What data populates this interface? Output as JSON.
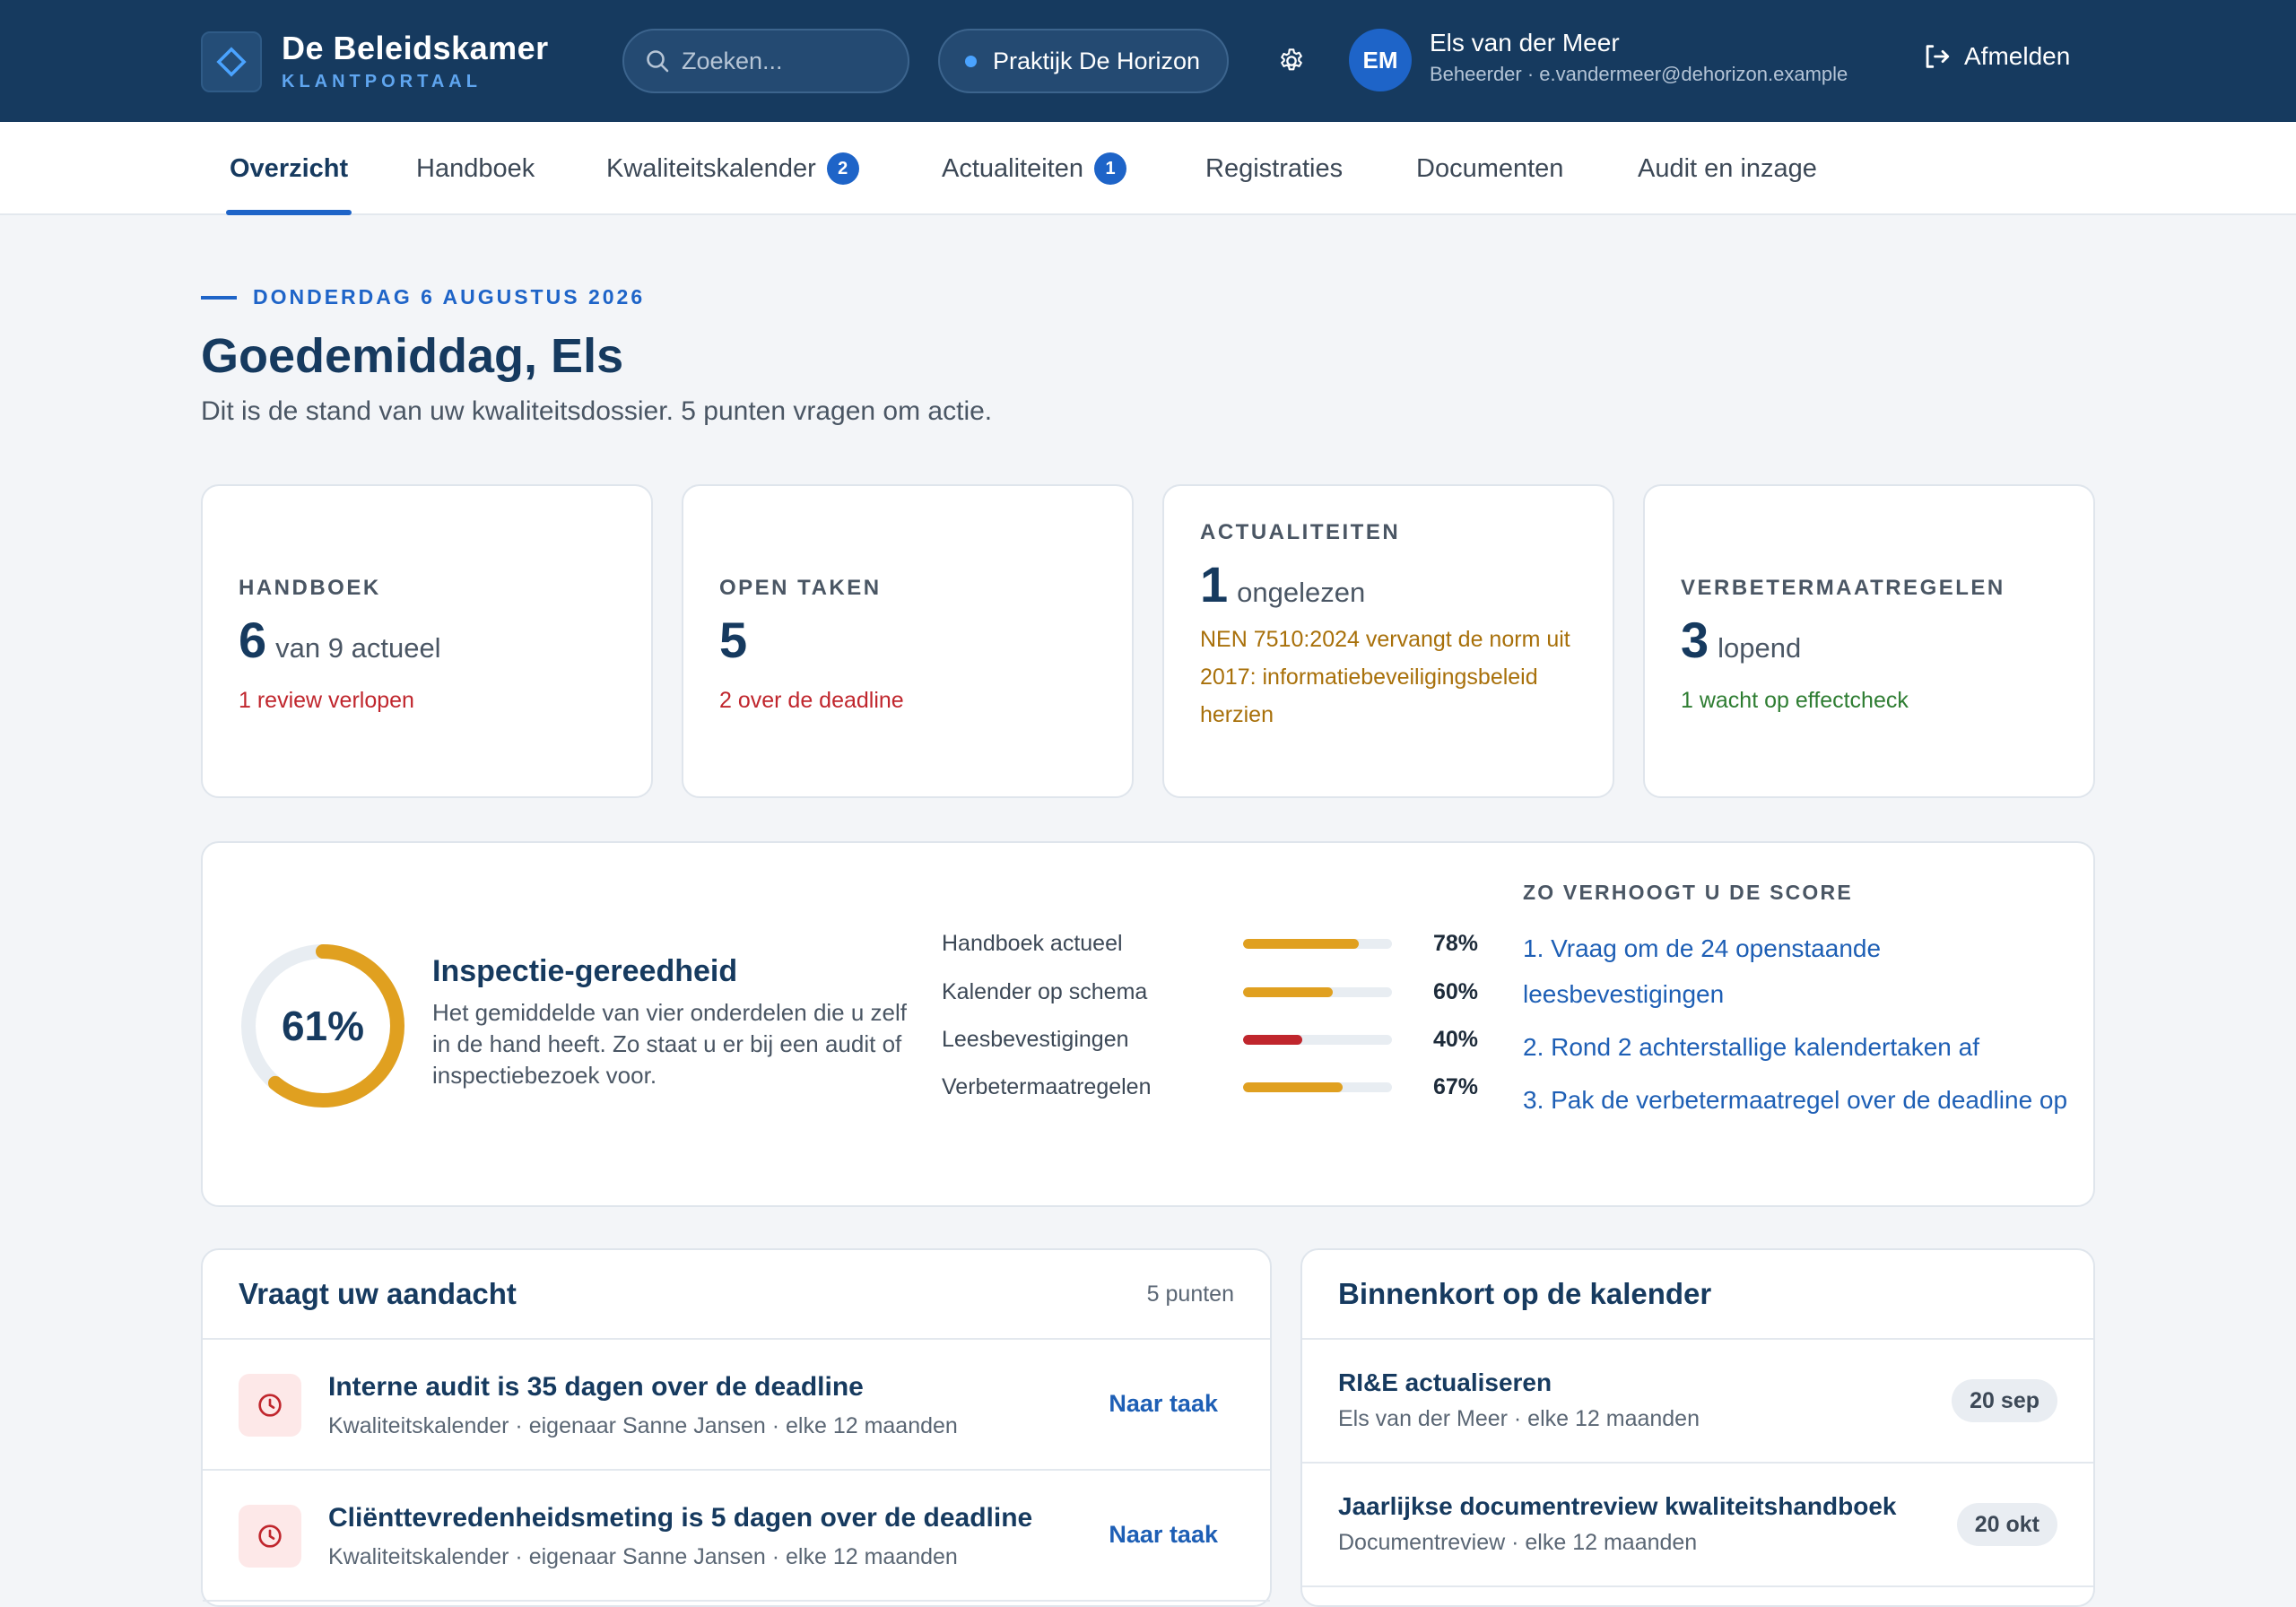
{
  "brand": {
    "name": "De Beleidskamer",
    "sub": "KLANTPORTAAL"
  },
  "header": {
    "search_placeholder": "Zoeken...",
    "practice": "Praktijk De Horizon",
    "user": {
      "initials": "EM",
      "name": "Els van der Meer",
      "meta": "Beheerder · e.vandermeer@dehorizon.example"
    },
    "logout": "Afmelden"
  },
  "nav": [
    {
      "label": "Overzicht",
      "active": true
    },
    {
      "label": "Handboek"
    },
    {
      "label": "Kwaliteitskalender",
      "badge": "2"
    },
    {
      "label": "Actualiteiten",
      "badge": "1"
    },
    {
      "label": "Registraties"
    },
    {
      "label": "Documenten"
    },
    {
      "label": "Audit en inzage"
    }
  ],
  "intro": {
    "date": "DONDERDAG 6 AUGUSTUS 2026",
    "greeting": "Goedemiddag, Els",
    "summary": "Dit is de stand van uw kwaliteitsdossier. 5 punten vragen om actie."
  },
  "stats": [
    {
      "label": "HANDBOEK",
      "value": "6",
      "unit": "van 9 actueel",
      "note": "1 review verlopen",
      "note_color": "#c0262d"
    },
    {
      "label": "OPEN TAKEN",
      "value": "5",
      "unit": "",
      "note": "2 over de deadline",
      "note_color": "#c0262d"
    },
    {
      "label": "ACTUALITEITEN",
      "value": "1",
      "unit": "ongelezen",
      "note": "NEN 7510:2024 vervangt de norm uit 2017: informatiebeveiligingsbeleid herzien",
      "note_color": "#a8700a"
    },
    {
      "label": "VERBETERMAATREGELEN",
      "value": "3",
      "unit": "lopend",
      "note": "1 wacht op effectcheck",
      "note_color": "#2e7d32"
    }
  ],
  "readiness": {
    "score": "61%",
    "score_fraction": 0.61,
    "title": "Inspectie-gereedheid",
    "description": "Het gemiddelde van vier onderdelen die u zelf in de hand heeft. Zo staat u er bij een audit of inspectiebezoek voor.",
    "bars": [
      {
        "label": "Handboek actueel",
        "value": "78%",
        "fraction": 0.78,
        "color": "#e0a020"
      },
      {
        "label": "Kalender op schema",
        "value": "60%",
        "fraction": 0.6,
        "color": "#e0a020"
      },
      {
        "label": "Leesbevestigingen",
        "value": "40%",
        "fraction": 0.4,
        "color": "#c0262d"
      },
      {
        "label": "Verbetermaatregelen",
        "value": "67%",
        "fraction": 0.67,
        "color": "#e0a020"
      }
    ],
    "tips_title": "ZO VERHOOGT U DE SCORE",
    "tips": [
      "1. Vraag om de 24 openstaande leesbevestigingen",
      "2. Rond 2 achterstallige kalendertaken af",
      "3. Pak de verbetermaatregel over de deadline op"
    ]
  },
  "attention": {
    "title": "Vraagt uw aandacht",
    "count": "5 punten",
    "items": [
      {
        "title": "Interne audit is 35 dagen over de deadline",
        "sub": "Kwaliteitskalender · eigenaar Sanne Jansen · elke 12 maanden",
        "link": "Naar taak"
      },
      {
        "title": "Cliënttevredenheidsmeting is 5 dagen over de deadline",
        "sub": "Kwaliteitskalender · eigenaar Sanne Jansen · elke 12 maanden",
        "link": "Naar taak"
      }
    ]
  },
  "calendar": {
    "title": "Binnenkort op de kalender",
    "items": [
      {
        "title": "RI&E actualiseren",
        "sub": "Els van der Meer · elke 12 maanden",
        "date": "20 sep"
      },
      {
        "title": "Jaarlijkse documentreview kwaliteitshandboek",
        "sub": "Documentreview · elke 12 maanden",
        "date": "20 okt"
      }
    ]
  },
  "colors": {
    "header_bg": "#163a5f",
    "accent": "#1e64c8",
    "ring_track": "#e8edf2",
    "ring_fill": "#e0a020"
  }
}
